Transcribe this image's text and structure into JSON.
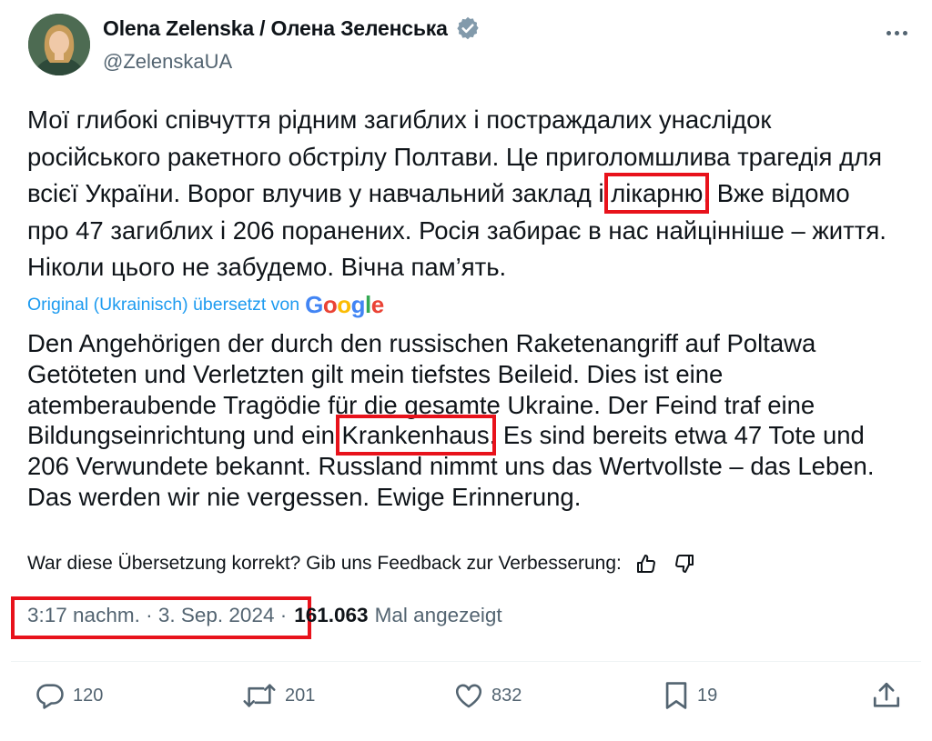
{
  "author": {
    "display_name": "Olena Zelenska / Олена Зеленська",
    "handle": "@ZelenskaUA",
    "verified_icon": "verified-badge-icon"
  },
  "tweet": {
    "text_before": "Мої глибокі співчуття рідним загиблих і постраждалих унаслідок російського ракетного обстрілу Полтави. Це приголомшлива трагедія для всієї України. Ворог влучив у навчальний заклад і ",
    "text_highlight": "лікарню",
    "text_after": ". Вже відомо про 47 загиблих і 206 поранених. Росія забирає в нас найцінніше – життя. Ніколи цього не забудемо. Вічна пам’ять."
  },
  "translation": {
    "label": "Original (Ukrainisch) übersetzt von",
    "provider": "Google",
    "text_before": "Den Angehörigen der durch den russischen Raketenangriff auf Poltawa Getöteten und Verletzten gilt mein tiefstes Beileid. Dies ist eine atemberaubende Tragödie für die gesamte Ukraine. Der Feind traf eine Bildungseinrichtung und ein ",
    "text_highlight": "Krankenhaus",
    "text_after": ". Es sind bereits etwa 47 Tote und 206 Verwundete bekannt. Russland nimmt uns das Wertvollste – das Leben. Das werden wir nie vergessen. Ewige Erinnerung.",
    "feedback_prompt": "War diese Übersetzung korrekt? Gib uns Feedback zur Verbesserung:"
  },
  "meta": {
    "time": "3:17 nachm.",
    "separator": "·",
    "date": "3. Sep. 2024",
    "views_count": "161.063",
    "views_label": "Mal angezeigt"
  },
  "actions": {
    "replies": "120",
    "reposts": "201",
    "likes": "832",
    "bookmarks": "19"
  },
  "colors": {
    "highlight": "#e8121b",
    "link": "#1d9bf0",
    "muted": "#536471",
    "text": "#0f1419"
  }
}
